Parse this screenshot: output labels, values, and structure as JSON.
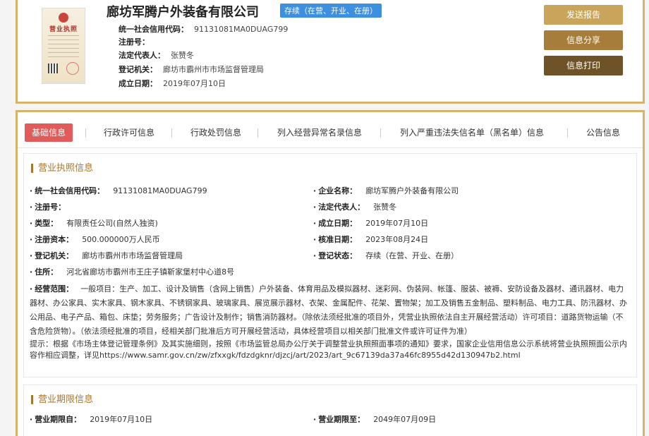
{
  "company": {
    "name": "廊坊军腾户外装备有限公司",
    "status": "存续（在营、开业、在册）",
    "license_label": "营业执照"
  },
  "header_fields": [
    {
      "key": "统一社会信用代码：",
      "value": "91131081MA0DUAG799"
    },
    {
      "key": "注册号：",
      "value": ""
    },
    {
      "key": "法定代表人：",
      "value": "张赞冬"
    },
    {
      "key": "登记机关：",
      "value": "廊坊市霸州市市场监督管理局"
    },
    {
      "key": "成立日期：",
      "value": "2019年07月10日"
    }
  ],
  "actions": {
    "report": "发送报告",
    "share": "信息分享",
    "print": "信息打印"
  },
  "tabs": [
    {
      "label": "基础信息",
      "active": true
    },
    {
      "label": "行政许可信息",
      "active": false
    },
    {
      "label": "行政处罚信息",
      "active": false
    },
    {
      "label": "列入经营异常名录信息",
      "active": false
    },
    {
      "label": "列入严重违法失信名单（黑名单）信息",
      "active": false
    },
    {
      "label": "公告信息",
      "active": false
    }
  ],
  "license_section": {
    "title": "营业执照信息",
    "left": [
      {
        "key": "统一社会信用代码：",
        "value": "91131081MA0DUAG799"
      },
      {
        "key": "注册号：",
        "value": ""
      },
      {
        "key": "类型：",
        "value": "有限责任公司(自然人独资)"
      },
      {
        "key": "注册资本：",
        "value": "500.000000万人民币"
      },
      {
        "key": "登记机关：",
        "value": "廊坊市霸州市市场监督管理局"
      },
      {
        "key": "住所：",
        "value": "河北省廊坊市霸州市王庄子镇靳家堡村中心道8号"
      }
    ],
    "right": [
      {
        "key": "企业名称：",
        "value": "廊坊军腾户外装备有限公司"
      },
      {
        "key": "法定代表人：",
        "value": "张赞冬"
      },
      {
        "key": "成立日期：",
        "value": "2019年07月10日"
      },
      {
        "key": "核准日期：",
        "value": "2023年08月24日"
      },
      {
        "key": "登记状态：",
        "value": "存续（在营、开业、在册）"
      }
    ],
    "scope_key": "经营范围：",
    "scope_value": "一般项目：生产、加工、设计及销售（含网上销售）户外装备、体育用品及模拟器材、迷彩网、伪装网、帐篷、服装、被褥、安防设备及器材、通讯器材、电力器材、办公家具、实木家具、钢木家具、不锈钢家具、玻璃家具、展览展示器材、衣架、金属配件、花架、置物架；加工及销售五金制品、塑料制品、电力工具、防汛器材、办公用品、电子产品、箱包、床垫；劳务服务；广告设计及制作；销售消防器材。（除依法须经批准的项目外，凭营业执照依法自主开展经营活动）许可项目：道路货物运输（不含危险货物）。（依法须经批准的项目，经相关部门批准后方可开展经营活动，具体经营项目以相关部门批准文件或许可证件为准）",
    "tip": "提示：根据《市场主体登记管理条例》及其实施细则，按照《市场监管总局办公厅关于调整营业执照照面事项的通知》要求，国家企业信用信息公示系统将营业执照照面公示内容作相应调整，详见https://www.samr.gov.cn/zw/zfxxgk/fdzdgknr/djzcj/art/2023/art_9c67139da37a46fc8955d42d130947b2.html"
  },
  "period_section": {
    "title": "营业期限信息",
    "from_key": "营业期限自：",
    "from_value": "2019年07月10日",
    "to_key": "营业期限至：",
    "to_value": "2049年07月09日"
  }
}
